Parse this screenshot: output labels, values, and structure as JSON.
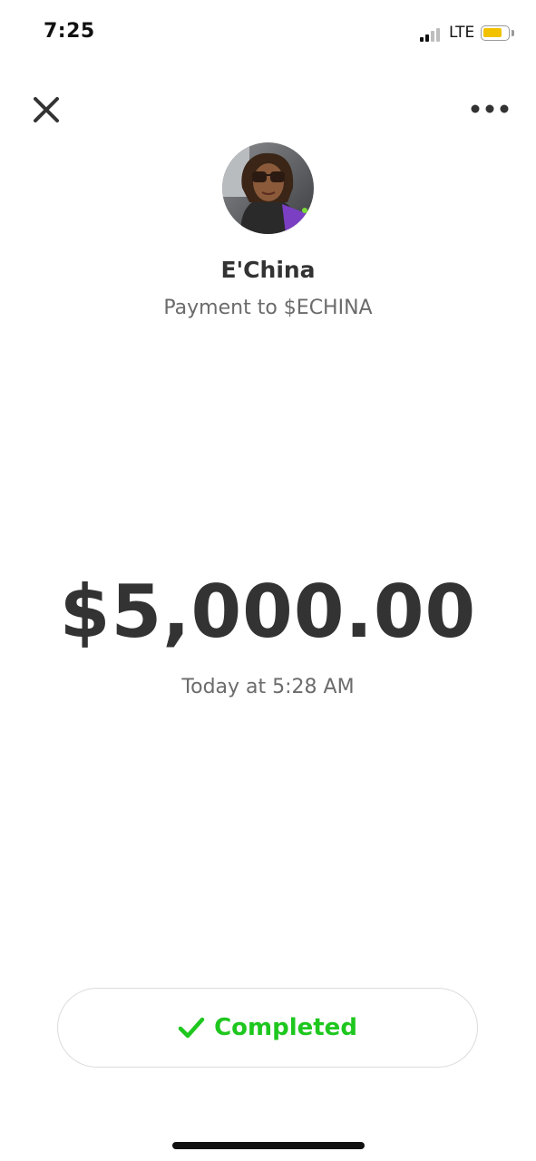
{
  "status_bar": {
    "time": "7:25",
    "network": "LTE",
    "signal_bars_active": 2,
    "signal_bars_total": 4,
    "battery_level": 0.8,
    "battery_color": "#f2c200"
  },
  "header": {
    "close_icon": "close-icon",
    "more_icon": "more-dots-icon"
  },
  "recipient": {
    "name": "E'China",
    "subtitle": "Payment to $ECHINA"
  },
  "payment": {
    "amount": "$5,000.00",
    "date": "Today at 5:28 AM"
  },
  "status": {
    "label": "Completed",
    "icon": "check-icon",
    "color": "#1ec71e"
  },
  "colors": {
    "primary_text": "#333333",
    "secondary_text": "#6b6b6b",
    "pill_border": "#dcdcdc"
  }
}
